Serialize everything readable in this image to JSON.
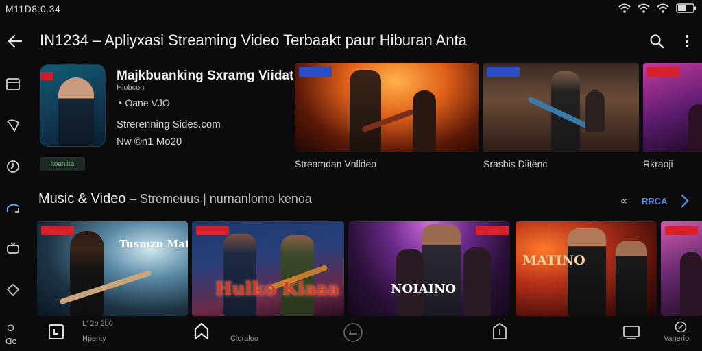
{
  "status": {
    "clock": "M11D8:0.34"
  },
  "appbar": {
    "title": "IN1234 – Apliyxasi Streaming Video Terbaakt paur Hiburan Anta"
  },
  "featured": {
    "title": "Majkbuanking Sxramg Viidat",
    "subtitle": "Hiobcon",
    "rating": "Oane VJO",
    "source": "Strerenninɡ Sides.com",
    "date": "Nw ©n1 Mo20",
    "chip": "ltoaniita"
  },
  "top_cards": [
    {
      "label": "Streamdan Vnlldeo"
    },
    {
      "label": "Srasbis Diitenc"
    },
    {
      "label": "Rkraoji"
    }
  ],
  "section": {
    "title": "Music & Video",
    "subtitle": "– Stremeuus | nurnanlomo kenoa",
    "icon_glyph": "∝",
    "link": "RRCA"
  },
  "bottom_cards": [
    {
      "poster_text": "Tusmzn Matu"
    },
    {
      "poster_text": "Hulko Kiaaa"
    },
    {
      "poster_text": "NOIAINO"
    },
    {
      "poster_text": "MATINO"
    },
    {
      "poster_text": ""
    }
  ],
  "bottom_nav": {
    "left_top": "O",
    "left_bottom": "Ɑc",
    "item1_top": "L' 2b 2b0",
    "item1_bottom": "Hpenty",
    "item2": "Cloraloo",
    "item3": "Vanerlo"
  },
  "colors": {
    "accent": "#4d8de8",
    "background": "#0b0b0d",
    "badge_red": "#d6212c",
    "badge_blue": "#2a4cc6"
  }
}
